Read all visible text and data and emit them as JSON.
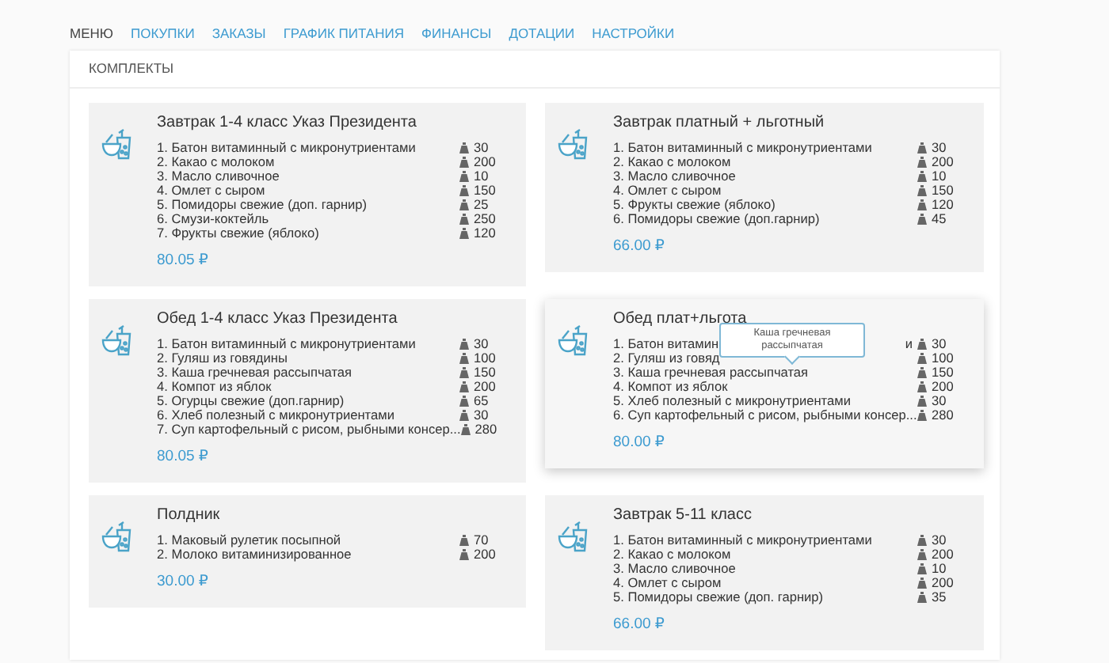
{
  "tabs": [
    {
      "label": "МЕНЮ",
      "selected": true
    },
    {
      "label": "ПОКУПКИ",
      "selected": false
    },
    {
      "label": "ЗАКАЗЫ",
      "selected": false
    },
    {
      "label": "ГРАФИК ПИТАНИЯ",
      "selected": false
    },
    {
      "label": "ФИНАНСЫ",
      "selected": false
    },
    {
      "label": "ДОТАЦИИ",
      "selected": false
    },
    {
      "label": "НАСТРОЙКИ",
      "selected": false
    }
  ],
  "panel": {
    "title": "КОМПЛЕКТЫ",
    "sets": [
      {
        "title": "Завтрак 1-4 класс Указ Президента",
        "hovered": false,
        "price": "80.05 ₽",
        "items": [
          {
            "name": "1. Батон витаминный с микронутриентами",
            "weight": "30"
          },
          {
            "name": "2. Какао с молоком",
            "weight": "200"
          },
          {
            "name": "3. Масло сливочное",
            "weight": "10"
          },
          {
            "name": "4. Омлет с сыром",
            "weight": "150"
          },
          {
            "name": "5. Помидоры свежие (доп. гарнир)",
            "weight": "25"
          },
          {
            "name": "6. Смузи-коктейль",
            "weight": "250"
          },
          {
            "name": "7. Фрукты свежие (яблоко)",
            "weight": "120"
          }
        ]
      },
      {
        "title": "Завтрак платный + льготный",
        "hovered": false,
        "price": "66.00 ₽",
        "items": [
          {
            "name": "1. Батон витаминный с микронутриентами",
            "weight": "30"
          },
          {
            "name": "2. Какао с молоком",
            "weight": "200"
          },
          {
            "name": "3. Масло сливочное",
            "weight": "10"
          },
          {
            "name": "4. Омлет с сыром",
            "weight": "150"
          },
          {
            "name": "5. Фрукты свежие (яблоко)",
            "weight": "120"
          },
          {
            "name": "6. Помидоры свежие (доп.гарнир)",
            "weight": "45"
          }
        ]
      },
      {
        "title": "Обед 1-4 класс Указ Президента",
        "hovered": false,
        "price": "80.05 ₽",
        "items": [
          {
            "name": "1. Батон витаминный с микронутриентами",
            "weight": "30"
          },
          {
            "name": "2. Гуляш из говядины",
            "weight": "100"
          },
          {
            "name": "3. Каша гречневая рассыпчатая",
            "weight": "150"
          },
          {
            "name": "4. Компот из яблок",
            "weight": "200"
          },
          {
            "name": "5. Огурцы свежие (доп.гарнир)",
            "weight": "65"
          },
          {
            "name": "6. Хлеб полезный с микронутриентами",
            "weight": "30"
          },
          {
            "name": "7. Суп картофельный с рисом, рыбными консер...",
            "weight": "280"
          }
        ]
      },
      {
        "title": "Обед плат+льгота",
        "hovered": true,
        "price": "80.00 ₽",
        "tooltip": "Каша гречневая рассыпчатая",
        "items": [
          {
            "name": "1. Батон витамин",
            "tail": "и",
            "weight": "30"
          },
          {
            "name": "2. Гуляш из говяд",
            "weight": "100"
          },
          {
            "name": "3. Каша гречневая рассыпчатая",
            "weight": "150"
          },
          {
            "name": "4. Компот из яблок",
            "weight": "200"
          },
          {
            "name": "5. Хлеб полезный с микронутриентами",
            "weight": "30"
          },
          {
            "name": "6. Суп картофельный с рисом, рыбными консер...",
            "weight": "280"
          }
        ]
      },
      {
        "title": "Полдник",
        "hovered": false,
        "price": "30.00 ₽",
        "items": [
          {
            "name": "1. Маковый рулетик посыпной",
            "weight": "70"
          },
          {
            "name": "2. Молоко витаминизированное",
            "weight": "200"
          }
        ]
      },
      {
        "title": "Завтрак 5-11 класс",
        "hovered": false,
        "price": "66.00 ₽",
        "items": [
          {
            "name": "1. Батон витаминный с микронутриентами",
            "weight": "30"
          },
          {
            "name": "2. Какао с молоком",
            "weight": "200"
          },
          {
            "name": "3. Масло сливочное",
            "weight": "10"
          },
          {
            "name": "4. Омлет с сыром",
            "weight": "200"
          },
          {
            "name": "5. Помидоры свежие (доп. гарнир)",
            "weight": "35"
          }
        ]
      }
    ]
  }
}
